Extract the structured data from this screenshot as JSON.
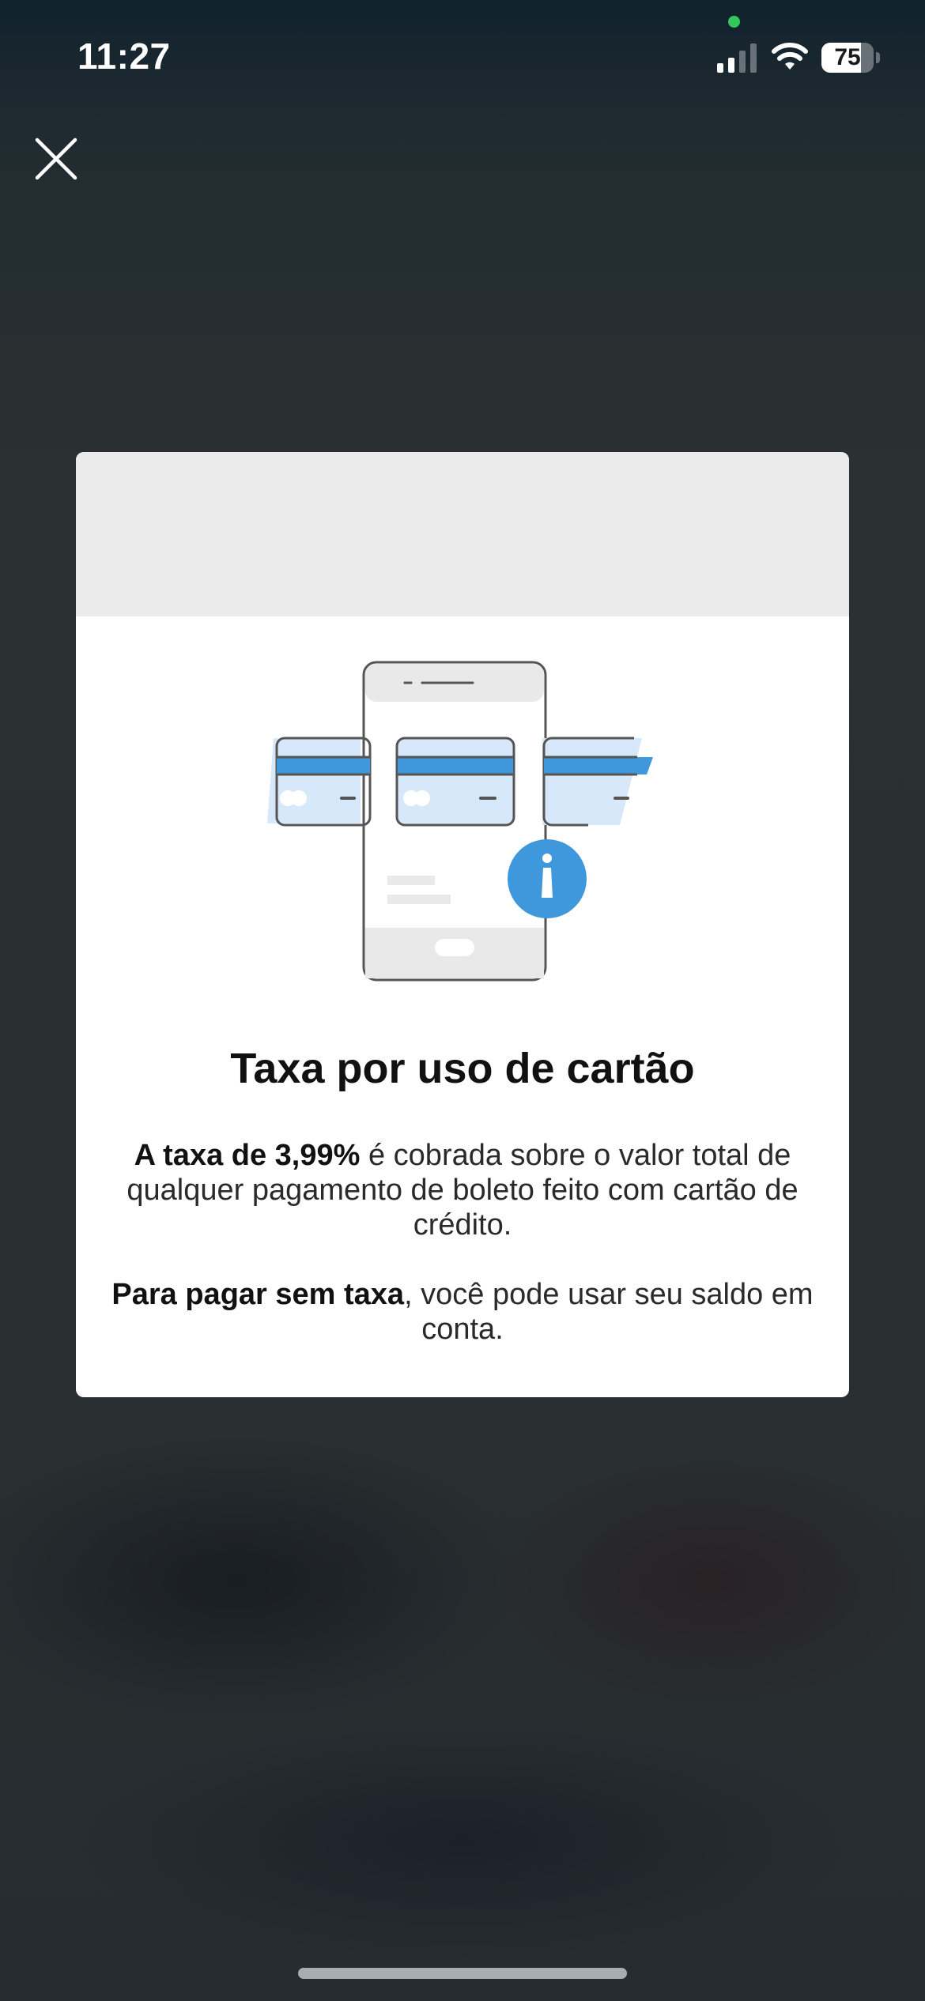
{
  "status_bar": {
    "time": "11:27",
    "battery_level": "75",
    "battery_fraction": 0.75,
    "signal_bars_active": 2,
    "signal_bars_total": 4,
    "icons": [
      "cellular-signal-icon",
      "wifi-icon",
      "battery-icon"
    ]
  },
  "close_button": {
    "icon": "close-icon"
  },
  "modal": {
    "illustration": "phone-with-credit-cards-info-illustration",
    "title": "Taxa por uso de cartão",
    "paragraph1": {
      "bold": "A taxa de 3,99%",
      "text": " é cobrada sobre o valor total de qualquer pagamento de boleto feito com cartão de crédito."
    },
    "paragraph2": {
      "bold": "Para pagar sem taxa",
      "text": ", você pode usar seu saldo em conta."
    }
  },
  "colors": {
    "accent_blue": "#3f97dc",
    "card_light_blue": "#d6e8fa",
    "modal_header_gray": "#ebebeb",
    "battery_fill": "#ffffff",
    "camera_indicator": "#34c759"
  }
}
